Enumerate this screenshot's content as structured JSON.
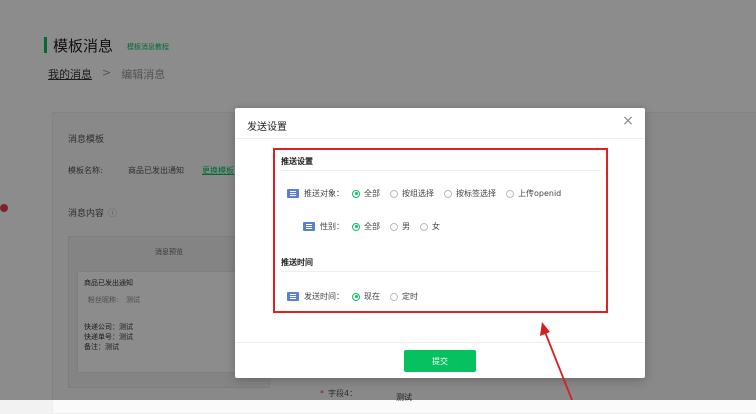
{
  "page": {
    "title": "模板消息",
    "tutorial_link": "模板消息教程",
    "breadcrumb": {
      "root": "我的消息",
      "sep": ">",
      "current": "编辑消息"
    }
  },
  "background": {
    "section_template": "消息模板",
    "template_name_label": "模板名称:",
    "template_name_value": "商品已发出通知",
    "change_template_link": "更换模板",
    "section_content": "消息内容",
    "preview": {
      "heading": "消息预览",
      "card_title": "商品已发出通知",
      "fan_nickname": "粉丝昵称:",
      "fan_value": "测试",
      "courier_company": "快递公司：测试",
      "courier_number": "快递单号：测试",
      "remark": "备注：测试"
    },
    "field4_label": "字段4：",
    "field4_value": "测试"
  },
  "modal": {
    "title": "发送设置",
    "close_icon": "close-icon",
    "push_settings": {
      "heading": "推送设置",
      "target_label": "推送对象：",
      "target_options": [
        "全部",
        "按组选择",
        "按标签选择",
        "上传openid"
      ],
      "target_selected": "全部",
      "gender_label": "性别：",
      "gender_options": [
        "全部",
        "男",
        "女"
      ],
      "gender_selected": "全部"
    },
    "push_time": {
      "heading": "推送时间",
      "time_label": "发送时间：",
      "time_options": [
        "现在",
        "定时"
      ],
      "time_selected": "现在"
    },
    "submit_label": "提交"
  },
  "colors": {
    "accent": "#07c160",
    "highlight": "#e02020",
    "tag_icon": "#5b7ed8"
  }
}
